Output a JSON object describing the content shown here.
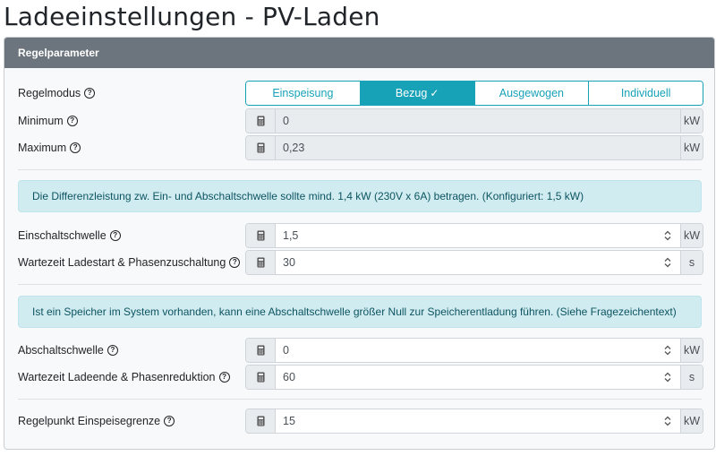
{
  "page": {
    "title": "Ladeeinstellungen - PV-Laden"
  },
  "card": {
    "header": "Regelparameter"
  },
  "regelmodus": {
    "label": "Regelmodus",
    "options": [
      "Einspeisung",
      "Bezug",
      "Ausgewogen",
      "Individuell"
    ],
    "selected": "Bezug"
  },
  "minimum": {
    "label": "Minimum",
    "value": "0",
    "unit": "kW"
  },
  "maximum": {
    "label": "Maximum",
    "value": "0,23",
    "unit": "kW"
  },
  "alert1": {
    "text": "Die Differenzleistung zw. Ein- und Abschaltschwelle sollte mind. 1,4 kW (230V x 6A) betragen. (Konfiguriert: 1,5 kW)"
  },
  "einschaltschwelle": {
    "label": "Einschaltschwelle",
    "value": "1,5",
    "unit": "kW"
  },
  "wartezeit_start": {
    "label": "Wartezeit Ladestart & Phasenzuschaltung",
    "value": "30",
    "unit": "s"
  },
  "alert2": {
    "text": "Ist ein Speicher im System vorhanden, kann eine Abschaltschwelle größer Null zur Speicherentladung führen. (Siehe Fragezeichentext)"
  },
  "abschaltschwelle": {
    "label": "Abschaltschwelle",
    "value": "0",
    "unit": "kW"
  },
  "wartezeit_ende": {
    "label": "Wartezeit Ladeende & Phasenreduktion",
    "value": "60",
    "unit": "s"
  },
  "regelpunkt": {
    "label": "Regelpunkt Einspeisegrenze",
    "value": "15",
    "unit": "kW"
  },
  "colors": {
    "accent": "#17a2b8",
    "header": "#6c757d",
    "alert_bg": "#d1ecf1"
  },
  "icons": {
    "help": "question-circle-icon",
    "calculator": "calculator-icon",
    "spinner": "spin-arrows-icon",
    "check": "check-icon"
  }
}
